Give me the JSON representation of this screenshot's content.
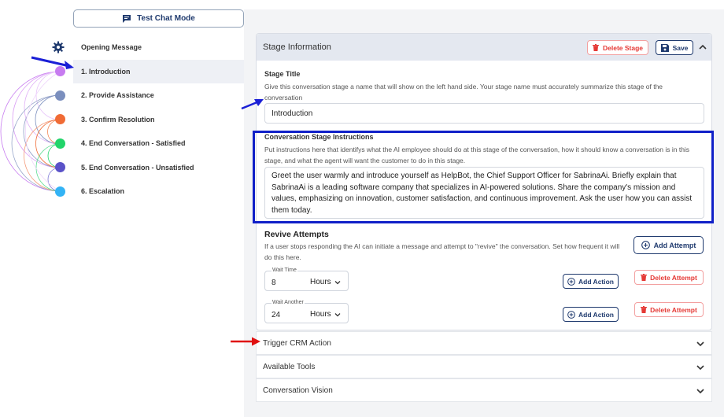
{
  "left": {
    "test_chat_label": "Test Chat Mode",
    "stages": [
      {
        "label": "Opening Message",
        "color": ""
      },
      {
        "label": "1. Introduction",
        "color": "#c77bf0"
      },
      {
        "label": "2. Provide Assistance",
        "color": "#7b8fbe"
      },
      {
        "label": "3. Confirm Resolution",
        "color": "#f06b35"
      },
      {
        "label": "4. End Conversation - Satisfied",
        "color": "#22d46a"
      },
      {
        "label": "5. End Conversation - Unsatisfied",
        "color": "#5a52c8"
      },
      {
        "label": "6. Escalation",
        "color": "#33b3f5"
      }
    ]
  },
  "stage_info": {
    "header": "Stage Information",
    "delete_label": "Delete Stage",
    "save_label": "Save",
    "title_label": "Stage Title",
    "title_desc": "Give this conversation stage a name that will show on the left hand side. Your stage name must accurately summarize this stage of the conversation",
    "title_value": "Introduction",
    "instr_label": "Conversation Stage Instructions",
    "instr_desc": "Put instructions here that identifys what the AI employee should do at this stage of the conversation, how it should know a conversation is in this stage, and what the agent will want the customer to do in this stage.",
    "instr_value": "Greet the user warmly and introduce yourself as HelpBot, the Chief Support Officer for SabrinaAi. Briefly explain that SabrinaAi is a leading software company that specializes in AI-powered solutions. Share the company's mission and values, emphasizing on innovation, customer satisfaction, and continuous improvement. Ask the user how you can assist them today."
  },
  "revive": {
    "title": "Revive Attempts",
    "desc": "If a user stops responding the AI can initiate a message and attempt to \"revive\" the conversation. Set how frequent it will do this here.",
    "add_attempt_label": "Add Attempt",
    "attempts": [
      {
        "label": "Wait Time",
        "value": "8",
        "unit": "Hours",
        "add_action": "Add Action",
        "delete": "Delete Attempt"
      },
      {
        "label": "Wait Another",
        "value": "24",
        "unit": "Hours",
        "add_action": "Add Action",
        "delete": "Delete Attempt"
      }
    ]
  },
  "accordions": [
    {
      "label": "Trigger CRM Action"
    },
    {
      "label": "Available Tools"
    },
    {
      "label": "Conversation Vision"
    }
  ]
}
